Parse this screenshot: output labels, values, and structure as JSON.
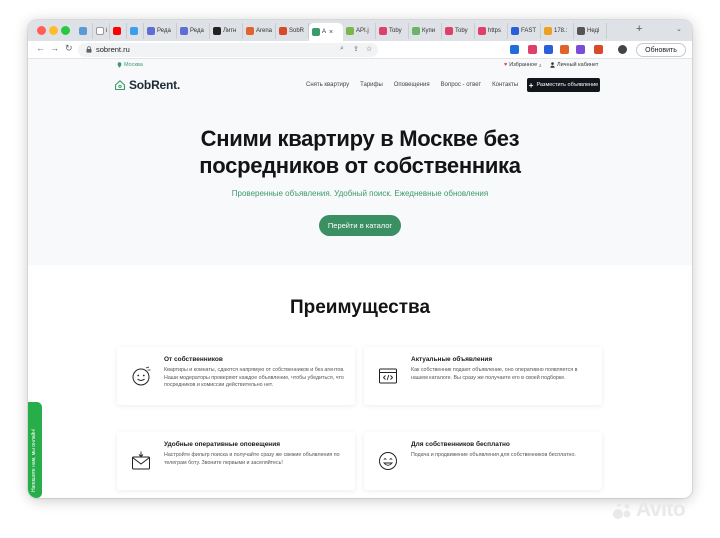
{
  "browser": {
    "tabs": [
      {
        "label": "",
        "color": "#5a9bd5",
        "narrow": true
      },
      {
        "label": "i",
        "color": "#ffffff",
        "narrow": true
      },
      {
        "label": "",
        "color": "#ff0000",
        "narrow": true
      },
      {
        "label": "",
        "color": "#39a0ed",
        "narrow": true
      },
      {
        "label": "Реда",
        "color": "#5d6fd6"
      },
      {
        "label": "Реда",
        "color": "#5d6fd6"
      },
      {
        "label": "Литн",
        "color": "#222222"
      },
      {
        "label": "Arena",
        "color": "#e0622d"
      },
      {
        "label": "SobR",
        "color": "#d94a2a"
      },
      {
        "label": "А",
        "color": "#3d9a6a",
        "active": true
      },
      {
        "label": "API.j",
        "color": "#7ab648"
      },
      {
        "label": "Toby",
        "color": "#e03f6a"
      },
      {
        "label": "Купи",
        "color": "#6bb36b"
      },
      {
        "label": "Toby",
        "color": "#e03f6a"
      },
      {
        "label": "https",
        "color": "#e03f6a"
      },
      {
        "label": "FAST",
        "color": "#2b5fd9"
      },
      {
        "label": "178.:",
        "color": "#f0a020"
      },
      {
        "label": "Неді",
        "color": "#555555"
      }
    ],
    "url": "sobrent.ru",
    "update_button": "Обновить",
    "extension_colors": [
      "#1e6fd9",
      "#e03f6a",
      "#2b5fd9",
      "#e0622d",
      "#7a4dd8",
      "#d94a2a"
    ]
  },
  "site": {
    "city": "Москва",
    "favorites": "Избранное",
    "favorites_count": "2",
    "cabinet": "Личный кабинет",
    "logo": "SobRent.",
    "nav": [
      "Снять квартиру",
      "Тарифы",
      "Оповещения",
      "Вопрос - ответ",
      "Контакты"
    ],
    "post_ad": "Разместить объявление",
    "hero_title_line1": "Сними квартиру в Москве без",
    "hero_title_line2": "посредников от собственника",
    "hero_subtitle": "Проверенные объявления. Удобный поиск. Ежедневные обновления",
    "catalog_button": "Перейти в каталог",
    "advantages_title": "Преимущества",
    "advantages": [
      {
        "icon": "smile-icon",
        "title": "От собственников",
        "text": "Квартиры и комнаты, сдаются напрямую от собственников и без агентов. Наши модераторы проверяют каждое объявление, чтобы убедиться, что посредников и комиссии действительно нет."
      },
      {
        "icon": "code-window-icon",
        "title": "Актуальные объявления",
        "text": "Как собственник подают объявление, оно оперативно появляется в нашем каталоге. Вы сразу же получаете его в своей подборке."
      },
      {
        "icon": "envelope-icon",
        "title": "Удобные оперативные оповещения",
        "text": "Настройте фильтр поиска и получайте сразу же свежие объявления по телеграм боту. Звоните первыми и заселяйтесь!"
      },
      {
        "icon": "happy-face-icon",
        "title": "Для собственников бесплатно",
        "text": "Подача и продвижение объявления для собственников бесплатно."
      }
    ],
    "chat_widget": "Напишите нам, мы онлайн!",
    "accent_color": "#3a8f63"
  },
  "watermark": "Avito"
}
